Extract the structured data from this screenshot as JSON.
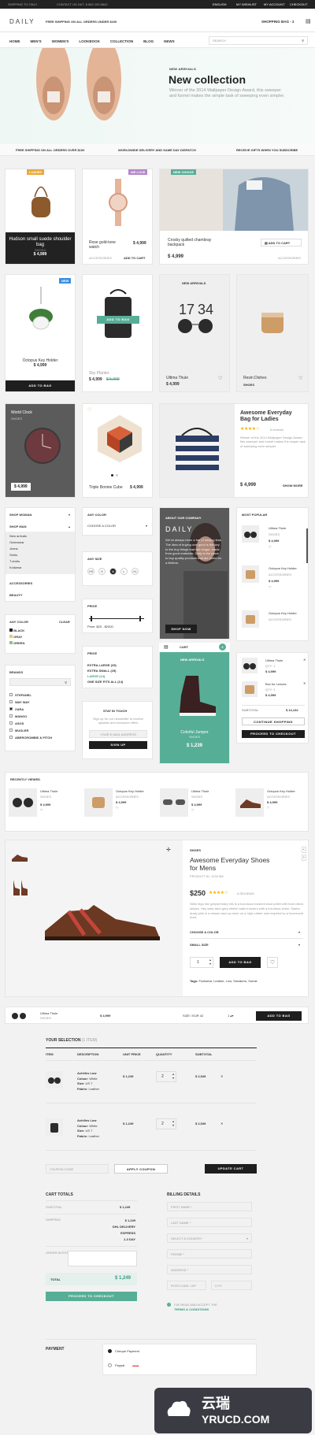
{
  "topbar": {
    "shipping": "SHIPPING TO ITALY",
    "contact": "CONTACT US 24/7: 8 800 100 6642",
    "lang": "ENGLISH",
    "wishlist": "MY WISHLIST",
    "account": "MY ACCOUNT",
    "checkout": "CHECKOUT"
  },
  "header": {
    "logo": "DAILY",
    "promo": "FREE SHIPPING ON ALL ORDERS UNDER $100",
    "bag": "SHOPPING BAG - 2"
  },
  "nav": {
    "items": [
      "HOME",
      "MEN'S",
      "WOMEN'S",
      "LOOKBOOK",
      "COLLECTION",
      "BLOG",
      "NEWS"
    ],
    "search_placeholder": "SEARCH"
  },
  "hero": {
    "kicker": "NEW ARRIVALS",
    "title": "New collection",
    "text": "Winner of the 2014 Wallpaper Design Award, this sweeper and funnel makes the simple task of sweeping even simpler."
  },
  "benefits": [
    "FREE SHIPPING ON ALL ORDERS OVER $100",
    "WORLDWIDE DELIVERY AND SAME DAY DISPATCH",
    "RECEIVE GIFTS WHEN YOU SUBSCRIBE"
  ],
  "grid1": {
    "bag": {
      "badge": "LUXURY",
      "name": "Hudson small suede shoulder bag",
      "cat": "SHOES",
      "price": "$ 4,999"
    },
    "watch": {
      "badge": "WE LOVE",
      "name": "Rose gold-tone watch",
      "price": "$ 4,999",
      "cat": "ACCESSORIES",
      "add": "ADD TO CART"
    },
    "backpack": {
      "badge": "NEW CHOICE",
      "name": "Crosby quilted chambray backpack",
      "price": "$ 4,999",
      "add": "ADD TO CART",
      "cat": "ACCESSORIES"
    }
  },
  "grid2": {
    "plant": {
      "badge": "NEW",
      "name": "Octopus Key Holder",
      "price": "$ 4,999",
      "btn": "ADD TO BAG"
    },
    "sky": {
      "btn": "ADD TO BAG",
      "name": "Sky Planter",
      "price": "$ 4,999",
      "old": "$ 5,999"
    },
    "glasses": {
      "kicker": "NEW ARRIVALS",
      "name": "Ultima Thule",
      "price": "$ 4,999"
    },
    "bowl": {
      "name": "Resin Dishes",
      "cat": "SHOES"
    }
  },
  "grid3": {
    "clock": {
      "name": "World Clock",
      "cat": "SHOES",
      "price": "$ 4,999"
    },
    "cube": {
      "name": "Triple Bonnie Cube",
      "price": "$ 4,999"
    },
    "everyday": {
      "title": "Awesome Everyday Bag for Ladies",
      "reviews": "6 reviews",
      "text": "Winner of the 2014 Wallpaper Design Award, this sweeper and funnel makes the simple task of sweeping even simpler.",
      "price": "$ 4,999",
      "more": "SHOW MORE"
    }
  },
  "filters": {
    "shop_woman": "SHOP WOMAN",
    "shop_man": "SHOP MAN",
    "sub": [
      "New arrivals",
      "Outerwear",
      "Jeans",
      "Shirts",
      "T-shirts",
      "Knitwear"
    ],
    "accessories": "ACCESSORIES",
    "beauty": "BEAUTY",
    "any_color": "ANY COLOR",
    "clear": "CLEAR",
    "colors": [
      "BLACK",
      "GRAY",
      "GREEN"
    ],
    "brands": "BRANDS",
    "brand_list": [
      "STEFANEL",
      "WAY WAY",
      "ZARA",
      "MANGO",
      "ASOS",
      "MUGLER",
      "ABERCROMBIE & FITCH"
    ],
    "color_label": "ANY COLOR",
    "choose_color": "CHOOSE A COLOR",
    "size_label": "ANY SIZE",
    "sizes": [
      "XS",
      "S",
      "M",
      "L",
      "XL"
    ],
    "price_label": "PRICE",
    "price_range": "Price: $20 - $2000",
    "size_list": [
      "EXTRA LARGE (25)",
      "EXTRA SMALL (25)",
      "LARGE (14)",
      "ONE SIZE FITS ALL (14)"
    ],
    "touch": "STAY IN TOUCH",
    "touch_text": "Sign up for our newsletter to receive updates and exclusive offers",
    "email_placeholder": "YOUR E-MAIL ADDRESS",
    "signup": "SIGN UP"
  },
  "about": {
    "kicker": "ABOUT OUR COMPANY",
    "brand": "DAILY",
    "text": "We've always been a fan of owning less. The idea of buying one good is the key to the buy things that last longer, made from good materials. Daily is the place to buy quality products that are loved for a lifetime.",
    "btn": "SHOP NOW"
  },
  "feature": {
    "kicker": "NEW ARRIVALS",
    "name": "Colorful Jumper",
    "cat": "SHOES",
    "price": "$ 1,239"
  },
  "cart": {
    "label": "CART",
    "count": "2",
    "items": [
      {
        "name": "Ultima Thule",
        "qty": "QTY: 1",
        "price": "$ 4,999"
      },
      {
        "name": "Box for Leaves",
        "qty": "QTY: 1",
        "price": "$ 4,999"
      }
    ],
    "subtotal_label": "SUBTOTAL",
    "subtotal": "$ 14,132",
    "continue": "CONTINUE SHOPPING",
    "proceed": "PROCEED TO CHECKOUT"
  },
  "popular": {
    "title": "MOST POPULAR",
    "items": [
      {
        "name": "Ultima Thule",
        "cat": "SHOES",
        "price": "$ 4,999"
      },
      {
        "name": "Octopus Key Holder",
        "cat": "ACCESSORIES",
        "price": "$ 4,999"
      },
      {
        "name": "Octopus Key Holder",
        "cat": "ACCESSORIES",
        "price": ""
      }
    ]
  },
  "recent": {
    "title": "RECENTLY VIEWED",
    "items": [
      {
        "name": "Ultima Thule",
        "cat": "SHOES",
        "price": "$ 4,999"
      },
      {
        "name": "Octopus Key Holder",
        "cat": "ACCESSORIES",
        "price": "$ 4,999"
      },
      {
        "name": "Ultima Thule",
        "cat": "SHOES",
        "price": "$ 4,999"
      },
      {
        "name": "Octopus Key Holder",
        "cat": "ACCESSORIES",
        "price": "$ 4,999"
      }
    ]
  },
  "product": {
    "cat": "SHOES",
    "title": "Awesome Everyday Shoes for Mens",
    "code": "PRODUCT ID: 1234 5M",
    "price": "$250",
    "reviews": "6 REVIEWS",
    "desc": "Nello lego mix grey/primary mix is a luxurious brushed wool pellet with bold check stripes. Hey satin dark grey stretch satin trousers with a luxurious shine. Sasha dusty pink is a classic lace-up shoe on a high rubber sole inspired by a hovercraft boat.",
    "color": "CHOOSE A COLOR",
    "size": "SMALL SIZE",
    "qty": "1",
    "add": "ADD TO BAG",
    "tags_label": "Tags:",
    "tags": "Footwear, Leather, Low, Sneakers, Suede"
  },
  "sticky": {
    "name": "Ultima Thule",
    "cat": "SHOES",
    "price": "$ 4,999",
    "size": "SIZE / EUR 42",
    "qty": "1",
    "add": "ADD TO BAG"
  },
  "selection": {
    "title": "YOUR SELECTION",
    "count": "(1 ITEM)",
    "headers": [
      "ITEM",
      "DESCRIPTION",
      "UNIT PRICE",
      "QUANTITY",
      "SUBTOTAL"
    ],
    "rows": [
      {
        "name": "Achilles Low",
        "colour": "White",
        "size": "US 7",
        "fabric": "Leather",
        "unit": "$ 1,249",
        "qty": "2",
        "subtotal": "$ 2,549"
      },
      {
        "name": "Achilles Low",
        "colour": "White",
        "size": "US 7",
        "fabric": "Leather",
        "unit": "$ 1,249",
        "qty": "2",
        "subtotal": "$ 2,549"
      }
    ],
    "coupon_placeholder": "COUPON CODE",
    "apply": "APPLY COUPON",
    "update": "UPDATE CART"
  },
  "totals": {
    "title": "CART TOTALS",
    "subtotal_label": "SUBTOTAL",
    "subtotal": "$ 1,249",
    "shipping_label": "SHIPPING",
    "shipping": [
      "$ 1,249",
      "DHL DELIVERY",
      "EXPRESS",
      "1-3 DAY"
    ],
    "notes_label": "ORDER NOTES",
    "total_label": "TOTAL",
    "total": "$ 1,249",
    "proceed": "PROCEED TO CHECKOUT"
  },
  "billing": {
    "title": "BILLING DETAILS",
    "fields": [
      "FIRST NAME *",
      "LAST NAME *",
      "SELECT A COUNTRY",
      "PHONE *",
      "ADDRESS *"
    ],
    "postcode": "POSTCODE / ZIP",
    "city": "CITY",
    "terms": "I'VE READ AND ACCEPT THE",
    "terms_link": "TERMS & CONDITIONS"
  },
  "payment": {
    "title": "PAYMENT",
    "options": [
      "Cheque Payment",
      "Paypal"
    ]
  },
  "watermark": {
    "cn": "云瑞",
    "url": "YRUCD.COM"
  },
  "colors": {
    "accent": "#57ae96",
    "dark": "#1e1e1e",
    "star": "#f2b400"
  }
}
